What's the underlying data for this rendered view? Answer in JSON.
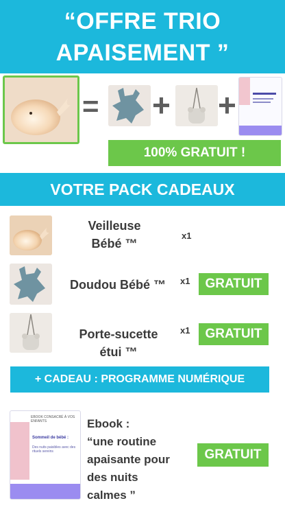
{
  "header": {
    "line1": "“OFFRE TRIO",
    "line2": "APAISEMENT ”"
  },
  "equation": {
    "equals_sign": "=",
    "plus_sign": "+",
    "badge": "100% GRATUIT !"
  },
  "section_title": "VOTRE PACK CADEAUX",
  "items": [
    {
      "title_line1": "Veilleuse",
      "title_line2": "Bébé ™",
      "qty": "x1",
      "badge": ""
    },
    {
      "title_line1": "Doudou Bébé ™",
      "title_line2": "",
      "qty": "x1",
      "badge": "GRATUIT"
    },
    {
      "title_line1": "Porte-sucette",
      "title_line2": "étui ™",
      "qty": "x1",
      "badge": "GRATUIT"
    }
  ],
  "bonus_bar": "+ CADEAU : PROGRAMME NUMÉRIQUE",
  "ebook": {
    "lines": [
      "Ebook :",
      "“une routine",
      "apaisante pour",
      "des nuits",
      "calmes ”"
    ],
    "badge": "GRATUIT",
    "cover": {
      "top_text": "EBOOK CONSACRÉ À VOS ENFANTS",
      "title": "Sommeil de bébé :",
      "subtitle": "Des nuits paisibles avec des rituels sereins"
    }
  },
  "colors": {
    "brand_blue": "#1cb8dc",
    "badge_green": "#6cc74a",
    "text_dark": "#3a3a3a",
    "plus_grey": "#5e5e5e"
  }
}
